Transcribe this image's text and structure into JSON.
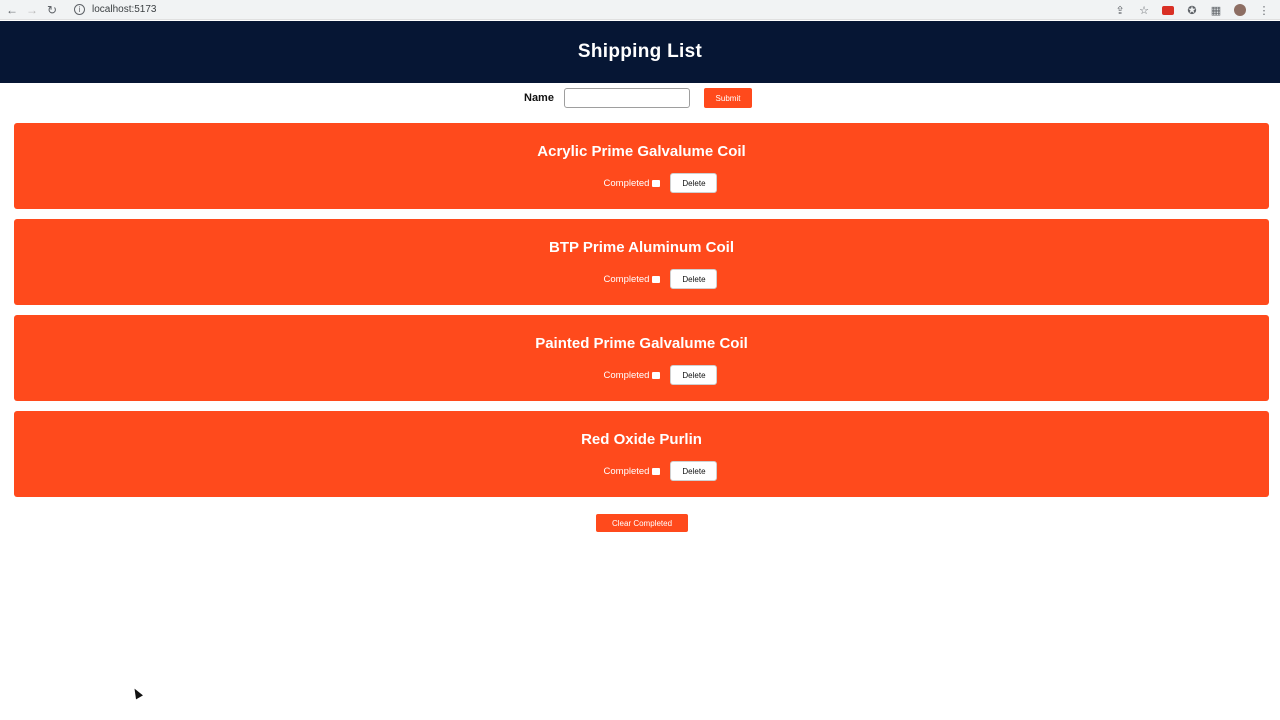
{
  "browser": {
    "url": "localhost:5173",
    "icons": [
      "back-icon",
      "forward-icon",
      "reload-icon",
      "info-icon",
      "share-icon",
      "star-icon",
      "extension-icon",
      "puzzle-icon",
      "sidebar-icon",
      "profile-icon",
      "menu-icon"
    ]
  },
  "header": {
    "title": "Shipping List"
  },
  "form": {
    "name_label": "Name",
    "name_value": "",
    "submit_label": "Submit"
  },
  "items": [
    {
      "title": "Acrylic Prime Galvalume Coil",
      "completed_label": "Completed",
      "completed": false,
      "delete_label": "Delete"
    },
    {
      "title": "BTP Prime Aluminum Coil",
      "completed_label": "Completed",
      "completed": false,
      "delete_label": "Delete"
    },
    {
      "title": "Painted Prime Galvalume Coil",
      "completed_label": "Completed",
      "completed": false,
      "delete_label": "Delete"
    },
    {
      "title": "Red Oxide Purlin",
      "completed_label": "Completed",
      "completed": false,
      "delete_label": "Delete"
    }
  ],
  "clear_label": "Clear Completed",
  "colors": {
    "header_bg": "#061634",
    "accent": "#ff4a1c",
    "text_light": "#ffffff"
  }
}
